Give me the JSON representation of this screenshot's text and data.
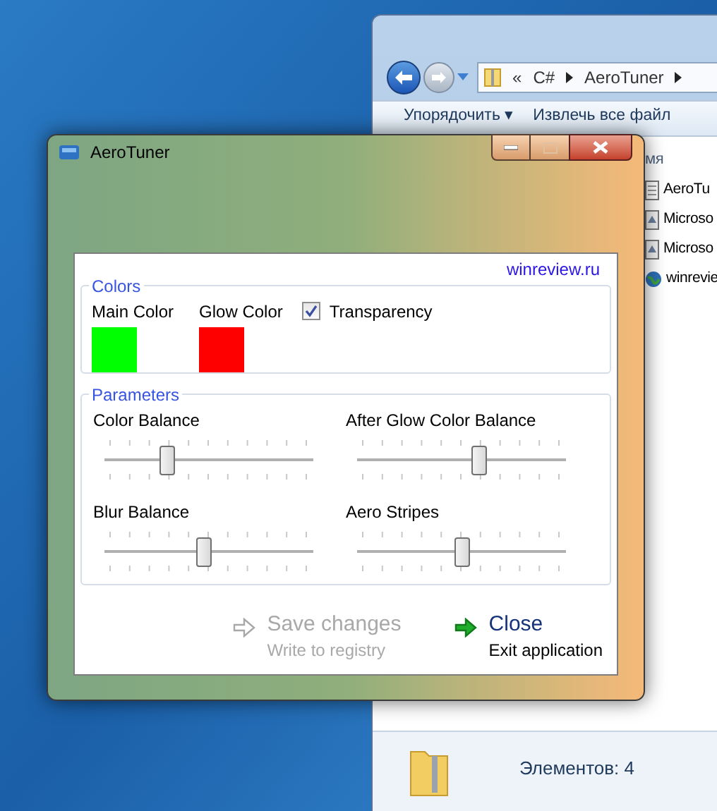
{
  "explorer": {
    "address": [
      {
        "kind": "chevron",
        "text": "«"
      },
      {
        "kind": "crumb",
        "text": "C#"
      },
      {
        "kind": "crumb",
        "text": "AeroTuner"
      }
    ],
    "toolbar": [
      "Упорядочить ▾",
      "Извлечь все файл"
    ],
    "column_header": "мя",
    "files": [
      {
        "kind": "text",
        "name": "AeroTu"
      },
      {
        "kind": "installer",
        "name": "Microso"
      },
      {
        "kind": "installer",
        "name": "Microso"
      },
      {
        "kind": "web",
        "name": "winrevie"
      }
    ],
    "status": "Элементов: 4"
  },
  "window": {
    "title": "AeroTuner",
    "link": "winreview.ru",
    "colors": {
      "title": "Colors",
      "swatches": [
        {
          "label": "Main Color",
          "color": "#00ff00"
        },
        {
          "label": "Glow Color",
          "color": "#ff0000"
        }
      ],
      "transparency": {
        "label": "Transparency",
        "checked": true
      }
    },
    "parameters": {
      "title": "Parameters",
      "sliders": [
        {
          "label": "Color Balance",
          "level": 0.28
        },
        {
          "label": "After Glow Color Balance",
          "level": 0.59
        },
        {
          "label": "Blur Balance",
          "level": 0.47
        },
        {
          "label": "Aero Stripes",
          "level": 0.5
        }
      ]
    },
    "actions": [
      {
        "title": "Save changes",
        "subtitle": "Write to registry",
        "disabled": true
      },
      {
        "title": "Close",
        "subtitle": "Exit application",
        "disabled": false
      }
    ]
  }
}
